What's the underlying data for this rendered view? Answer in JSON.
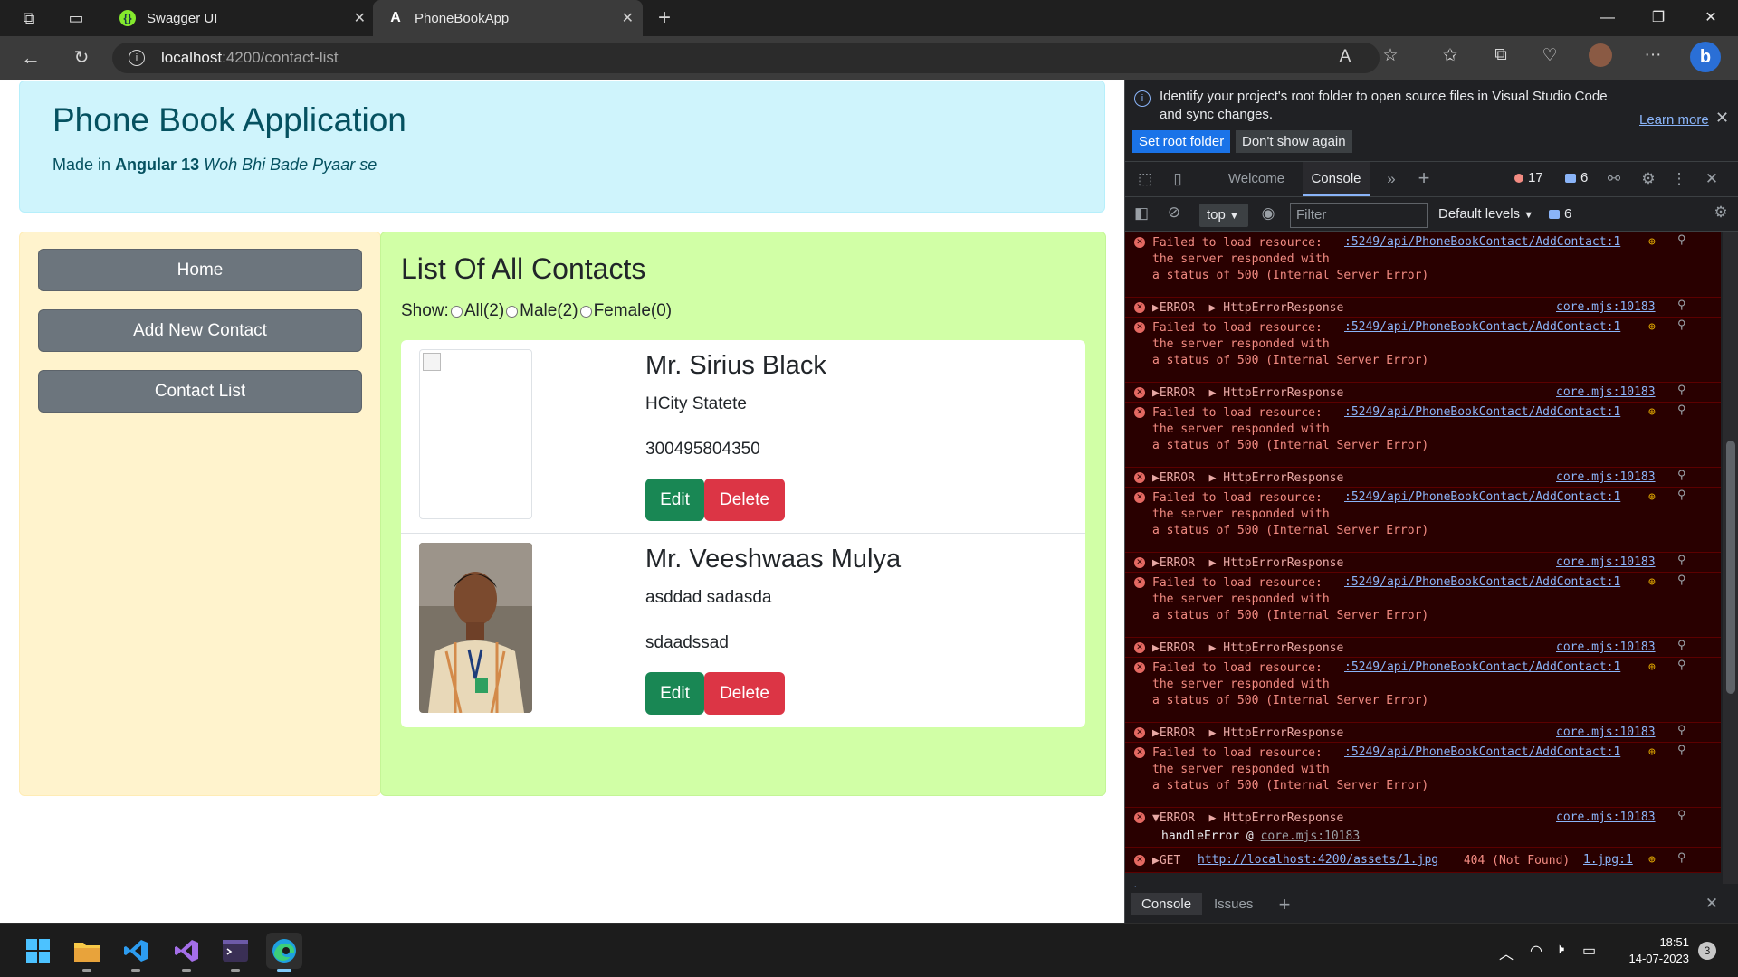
{
  "browser": {
    "tabs": [
      {
        "title": "Swagger UI",
        "favicon": "swagger-icon"
      },
      {
        "title": "PhoneBookApp",
        "favicon": "angular-icon"
      }
    ],
    "url_host": "localhost",
    "url_path": ":4200/contact-list"
  },
  "app": {
    "title": "Phone Book Application",
    "sub_prefix": "Made in",
    "sub_bold": "Angular 13",
    "sub_italic": "Woh Bhi Bade Pyaar se"
  },
  "nav": {
    "items": [
      {
        "label": "Home"
      },
      {
        "label": "Add New Contact"
      },
      {
        "label": "Contact List"
      }
    ]
  },
  "contacts": {
    "title": "List Of All Contacts",
    "show_label": "Show:",
    "filters": [
      {
        "label": "All(2)"
      },
      {
        "label": "Male(2)"
      },
      {
        "label": "Female(0)"
      }
    ],
    "edit_label": "Edit",
    "delete_label": "Delete",
    "items": [
      {
        "name": "Mr. Sirius Black",
        "address": "HCity Statete",
        "phone": "300495804350",
        "photo": "broken-image"
      },
      {
        "name": "Mr. Veeshwaas Mulya",
        "address": "asddad sadasda",
        "phone": "sdaadssad",
        "photo": "person-photo"
      }
    ]
  },
  "devtools": {
    "banner_text": "Identify your project's root folder to open source files in Visual Studio Code and sync changes.",
    "learn_more": "Learn more",
    "set_root": "Set root folder",
    "dont_show": "Don't show again",
    "tabs": [
      "Welcome",
      "Console"
    ],
    "error_count": "17",
    "message_count": "6",
    "context": "top",
    "filter_placeholder": "Filter",
    "levels": "Default levels",
    "toolbar_messages": "6",
    "log": [
      {
        "kind": "failed",
        "text": "Failed to load resource:\nthe server responded with\na status of 500 (Internal Server Error)",
        "link": ":5249/api/PhoneBookContact/AddContact:1"
      },
      {
        "kind": "error",
        "text": "▶ERROR  ▶ HttpErrorResponse",
        "link": "core.mjs:10183"
      },
      {
        "kind": "failed",
        "text": "Failed to load resource:\nthe server responded with\na status of 500 (Internal Server Error)",
        "link": ":5249/api/PhoneBookContact/AddContact:1"
      },
      {
        "kind": "error",
        "text": "▶ERROR  ▶ HttpErrorResponse",
        "link": "core.mjs:10183"
      },
      {
        "kind": "failed",
        "text": "Failed to load resource:\nthe server responded with\na status of 500 (Internal Server Error)",
        "link": ":5249/api/PhoneBookContact/AddContact:1"
      },
      {
        "kind": "error",
        "text": "▶ERROR  ▶ HttpErrorResponse",
        "link": "core.mjs:10183"
      },
      {
        "kind": "failed",
        "text": "Failed to load resource:\nthe server responded with\na status of 500 (Internal Server Error)",
        "link": ":5249/api/PhoneBookContact/AddContact:1"
      },
      {
        "kind": "error",
        "text": "▶ERROR  ▶ HttpErrorResponse",
        "link": "core.mjs:10183"
      },
      {
        "kind": "failed",
        "text": "Failed to load resource:\nthe server responded with\na status of 500 (Internal Server Error)",
        "link": ":5249/api/PhoneBookContact/AddContact:1"
      },
      {
        "kind": "error",
        "text": "▶ERROR  ▶ HttpErrorResponse",
        "link": "core.mjs:10183"
      },
      {
        "kind": "failed",
        "text": "Failed to load resource:\nthe server responded with\na status of 500 (Internal Server Error)",
        "link": ":5249/api/PhoneBookContact/AddContact:1"
      },
      {
        "kind": "error",
        "text": "▶ERROR  ▶ HttpErrorResponse",
        "link": "core.mjs:10183"
      },
      {
        "kind": "failed",
        "text": "Failed to load resource:\nthe server responded with\na status of 500 (Internal Server Error)",
        "link": ":5249/api/PhoneBookContact/AddContact:1"
      },
      {
        "kind": "expanded",
        "text": "▼ERROR  ▶ HttpErrorResponse",
        "link": "core.mjs:10183",
        "sub_text": "handleError @ ",
        "sub_link": "core.mjs:10183"
      },
      {
        "kind": "get",
        "text": "▶GET ",
        "url": "http://localhost:4200/assets/1.jpg",
        "status": " 404 (Not Found)",
        "link": "1.jpg:1"
      }
    ],
    "drawer_tabs": [
      "Console",
      "Issues"
    ]
  },
  "taskbar": {
    "time": "18:51",
    "date": "14-07-2023",
    "notifications": "3"
  }
}
